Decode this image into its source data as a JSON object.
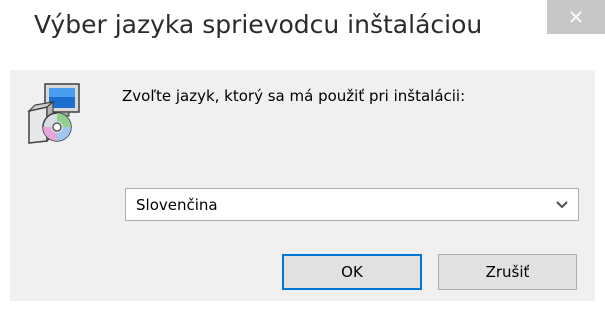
{
  "window": {
    "title": "Výber jazyka sprievodcu inštaláciou"
  },
  "dialog": {
    "prompt": "Zvoľte jazyk, ktorý sa má použiť pri inštalácii:",
    "language_select": {
      "selected": "Slovenčina"
    },
    "buttons": {
      "ok_label": "OK",
      "cancel_label": "Zrušiť"
    }
  },
  "icons": {
    "close": "close-icon",
    "app": "setup-installer-icon",
    "dropdown": "chevron-down-icon"
  },
  "colors": {
    "close_button_bg": "#c7c7c7",
    "dialog_bg": "#f0f0f0",
    "default_button_border": "#0078d7",
    "button_bg": "#e1e1e1"
  }
}
